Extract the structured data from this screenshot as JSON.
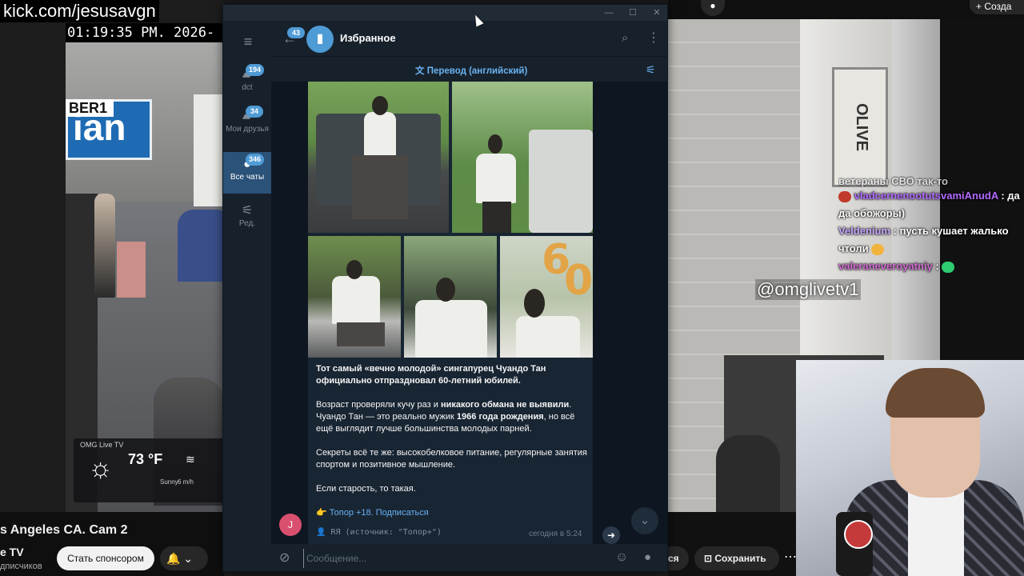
{
  "stream": {
    "kick_url": "kick.com/jesusavgn",
    "cam_time": "01:19:35 PM.  2026-",
    "sign_top": "BER1",
    "sign_main": "ian",
    "weather_label": "OMG Live TV",
    "weather_temp": "73 °F",
    "weather_sub": "Sunny",
    "weather_wind_sub": "6 m/h",
    "title": "s Angeles CA. Cam 2",
    "channel": "e TV",
    "subs": "дписчиков",
    "sponsor_label": "Стать спонсором",
    "bell_label": "🔔 ⌄",
    "create_label": "+ Созда",
    "subscribe_part": "ся",
    "save_label": "Сохранить",
    "street_sign": "OLIVE",
    "watermark": "@omglivetv1"
  },
  "chat": {
    "top_line": "ветераны СВО так-то",
    "messages": [
      {
        "user": "vladcernenootutsvamiAnudA",
        "text": ": да да обожоры)"
      },
      {
        "user": "Veldenium",
        "text": ": пусть кушает жалько чтоли"
      },
      {
        "user": "valeraneveroyatniy",
        "text": ":"
      }
    ]
  },
  "telegram": {
    "folders": [
      {
        "label": "dct",
        "badge": "194"
      },
      {
        "label": "Мои друзья",
        "badge": "34"
      },
      {
        "label": "Все чаты",
        "badge": "346"
      },
      {
        "label": "Ред.",
        "badge": ""
      }
    ],
    "back_badge": "43",
    "chat_title": "Избранное",
    "translate_label": "Перевод (английский)",
    "message": {
      "p1_a": "Тот самый «вечно молодой» сингапурец Чуандо Тан официально отпраздновал 60-летний юбилей.",
      "p2_a": "Возраст проверяли кучу раз и ",
      "p2_b": "никакого обмана не выявили",
      "p2_c": ". Чуандо Тан — это реально мужик ",
      "p2_d": "1966 года рождения",
      "p2_e": ", но всё ещё выглядит лучше большинства молодых парней.",
      "p3": "Секреты всё те же: высокобелковое питание, регулярные занятия спортом и позитивное мышление.",
      "p4": "Если старость, то такая.",
      "link_prefix": "👉",
      "link": "Топор +18. Подписаться",
      "source": "👤 RЯ (источник: \"Топор+\")",
      "time": "сегодня в 5:24"
    },
    "sender_initial": "J",
    "input_placeholder": "Сообщение..."
  }
}
